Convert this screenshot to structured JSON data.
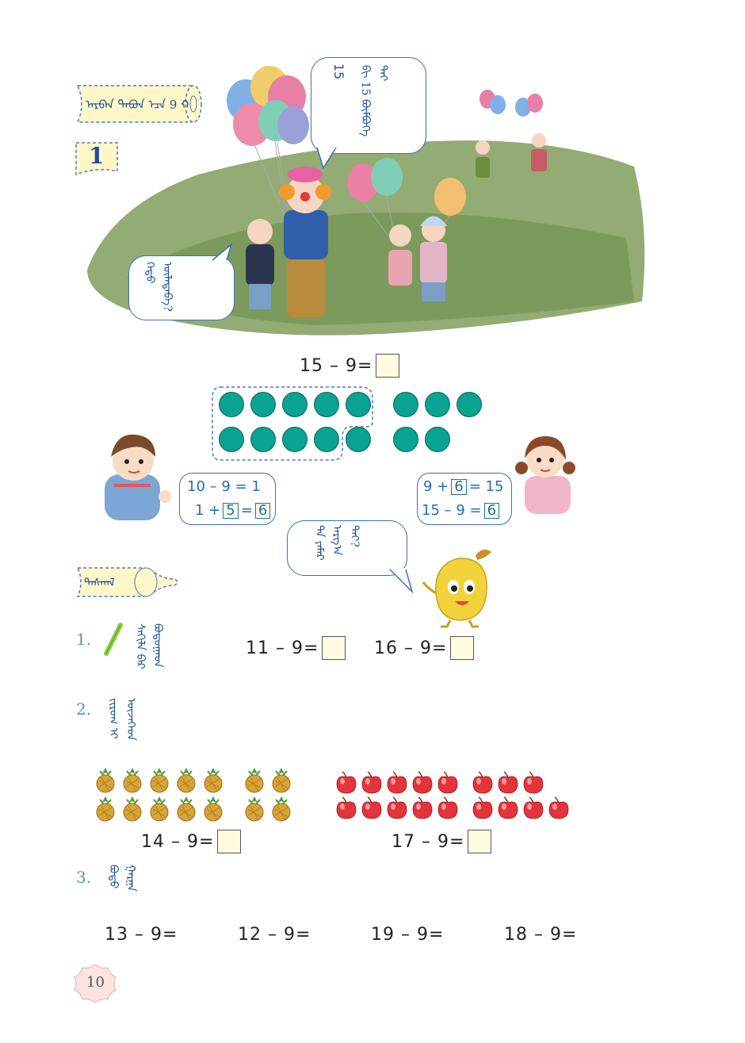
{
  "header": {
    "lesson_title_script": "ᠠᠷᠪᠠᠨ ᠲᠠᠪᠤᠨ ᠡᠴᠡ 9 ᠬᠠᠰᠤᠬᠤ",
    "section_number": "1"
  },
  "scene": {
    "clown_speech_number": "15",
    "clown_speech_script": "ᠪᠢ 15 ᠪᠥᠮᠪᠥᠭᠡ ᠲᠡᠢ",
    "boy_speech_script": "ᠬᠡᠳᠦ ᠦᠯᠡᠳᠡᠪᠡ?"
  },
  "main_equation": {
    "left": "15 – 9=",
    "answer": ""
  },
  "dots": {
    "top_row_count": 8,
    "bottom_row_count": 7,
    "color": "#0aa290"
  },
  "boy_method": {
    "line1": "10 – 9  = 1",
    "line2_prefix": "1 +",
    "line2_box": "5",
    "line2_mid": "=",
    "line2_result": "6"
  },
  "girl_method": {
    "line1_prefix": "9 +",
    "line1_box": "6",
    "line1_suffix": "= 15",
    "line2_prefix": "15 – 9  =",
    "line2_result": "6"
  },
  "fruit_speech_script": "ᠲᠠ ᠶᠠᠮᠠᠷ ᠠᠷᠭ᠎ᠠ ᠲᠠᠢ?",
  "practice": {
    "title_script": "ᠳᠠᠰᠬᠠᠯ",
    "items": [
      {
        "num": "1.",
        "script": "ᠰᠠᠬᠢᠯᠠ ᠪᠠᠷ ᠪᠣᠳᠣᠭᠠᠳ",
        "eq1": "11 – 9=",
        "eq2": "16 – 9="
      },
      {
        "num": "2.",
        "script": "ᠵᠢᠷᠤᠭ ᠢ ᠦᠵᠡᠭᠡᠳ",
        "eq1": "14 – 9=",
        "eq2": "17 – 9="
      },
      {
        "num": "3.",
        "script": "ᠪᠣᠳᠣ ᠭᠠᠷᠭᠠ",
        "calcs": [
          "13 – 9=",
          "12 – 9=",
          "19 – 9=",
          "18 – 9="
        ]
      }
    ]
  },
  "page_number": "10"
}
